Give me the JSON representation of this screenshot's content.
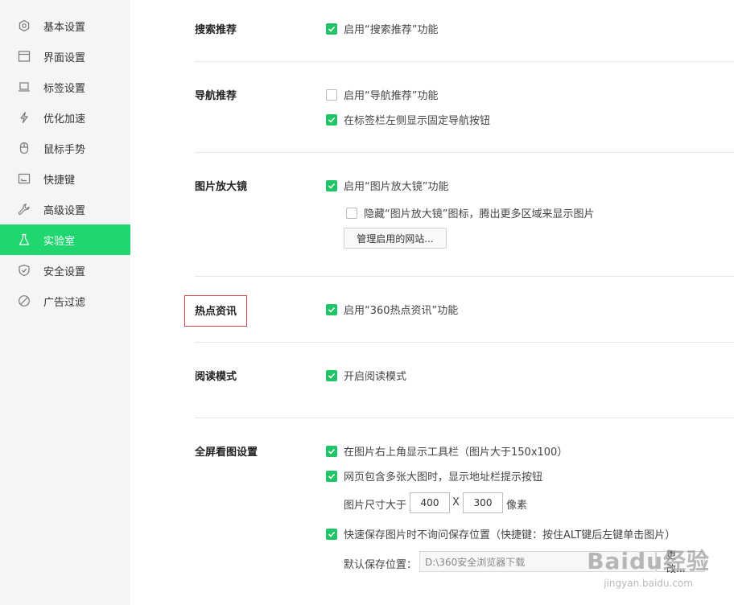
{
  "sidebar": {
    "items": [
      {
        "label": "基本设置",
        "icon": "gear-icon"
      },
      {
        "label": "界面设置",
        "icon": "window-icon"
      },
      {
        "label": "标签设置",
        "icon": "tab-icon"
      },
      {
        "label": "优化加速",
        "icon": "lightning-icon"
      },
      {
        "label": "鼠标手势",
        "icon": "mouse-icon"
      },
      {
        "label": "快捷键",
        "icon": "keyboard-icon"
      },
      {
        "label": "高级设置",
        "icon": "wrench-icon"
      },
      {
        "label": "实验室",
        "icon": "flask-icon",
        "active": true
      },
      {
        "label": "安全设置",
        "icon": "shield-icon"
      },
      {
        "label": "广告过滤",
        "icon": "block-icon"
      }
    ],
    "active_color": "#1fd66f"
  },
  "sections": {
    "search": {
      "title": "搜索推荐",
      "opt1": "启用“搜索推荐”功能"
    },
    "nav": {
      "title": "导航推荐",
      "opt1": "启用“导航推荐”功能",
      "opt2": "在标签栏左侧显示固定导航按钮"
    },
    "magnifier": {
      "title": "图片放大镜",
      "opt1": "启用“图片放大镜”功能",
      "opt2": "隐藏“图片放大镜”图标，腾出更多区域来显示图片",
      "manage_btn": "管理启用的网站..."
    },
    "hotnews": {
      "title": "热点资讯",
      "opt1": "启用“360热点资讯”功能"
    },
    "reading": {
      "title": "阅读模式",
      "opt1": "开启阅读模式"
    },
    "fullscreen": {
      "title": "全屏看图设置",
      "opt1": "在图片右上角显示工具栏（图片大于150x100）",
      "opt2": "网页包含多张大图时，显示地址栏提示按钮",
      "size_label": "图片尺寸大于",
      "width": "400",
      "x_label": "X",
      "height": "300",
      "unit_label": "像素",
      "opt3": "快速保存图片时不询问保存位置（快捷键：按住ALT键后左键单击图片）",
      "save_label": "默认保存位置：",
      "save_path": "D:\\360安全浏览器下载",
      "change_btn": "更改..."
    }
  },
  "watermark": {
    "brand": "Baidu经验",
    "url": "jingyan.baidu.com"
  },
  "accent_color": "#1fc466"
}
